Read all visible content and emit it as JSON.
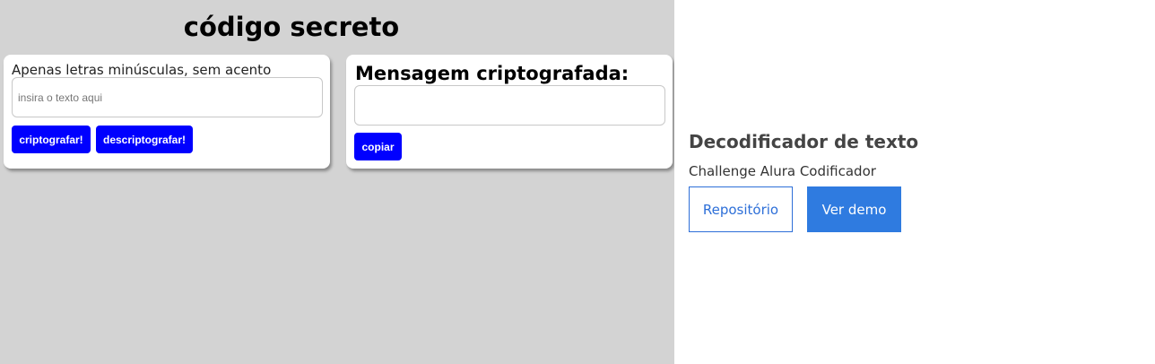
{
  "app": {
    "title": "código secreto",
    "input_card": {
      "hint": "Apenas letras minúsculas, sem acento",
      "placeholder": "insira o texto aqui",
      "value": "",
      "encrypt_label": "criptografar!",
      "decrypt_label": "descriptografar!"
    },
    "output_card": {
      "title": "Mensagem criptografada:",
      "value": "",
      "copy_label": "copiar"
    }
  },
  "project": {
    "title": "Decodificador de texto",
    "subtitle": "Challenge Alura Codificador",
    "repo_label": "Repositório",
    "demo_label": "Ver demo"
  },
  "colors": {
    "preview_bg": "#d3d3d3",
    "button_blue": "#0000ff",
    "accent_blue": "#2f7be0"
  }
}
